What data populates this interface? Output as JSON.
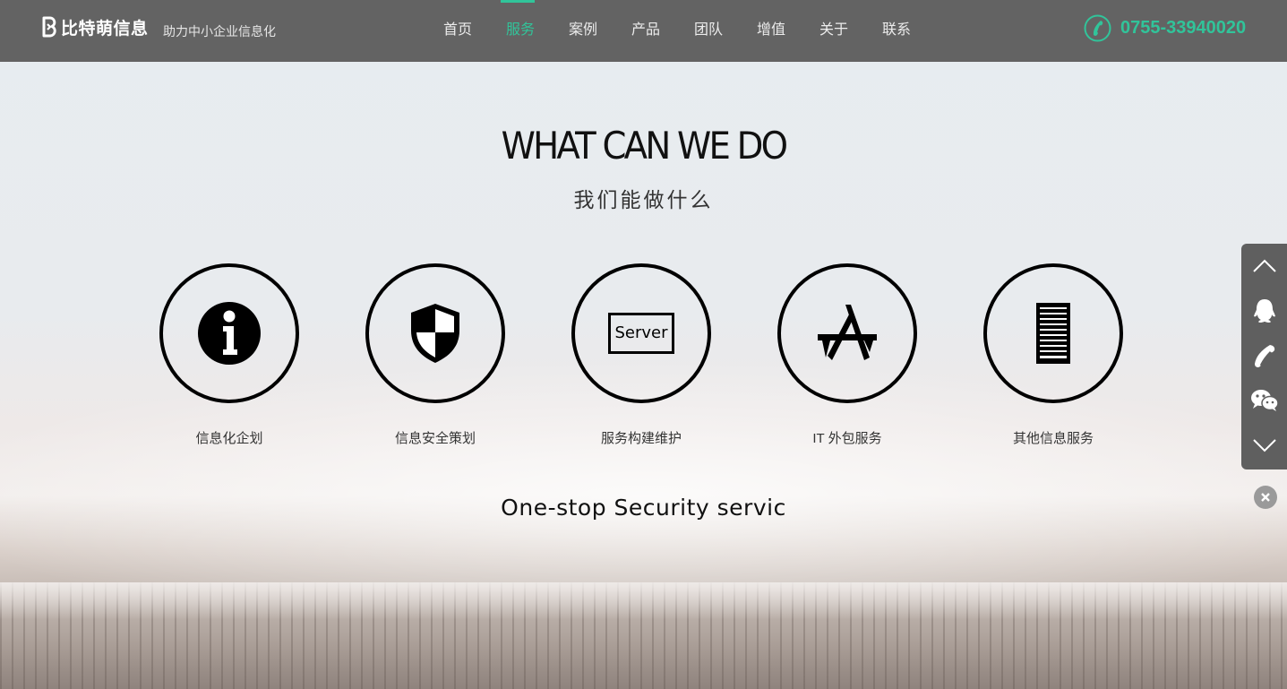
{
  "header": {
    "brand": "比特萌信息",
    "slogan": "助力中小企业信息化",
    "nav": [
      {
        "label": "首页",
        "active": false
      },
      {
        "label": "服务",
        "active": true
      },
      {
        "label": "案例",
        "active": false
      },
      {
        "label": "产品",
        "active": false
      },
      {
        "label": "团队",
        "active": false
      },
      {
        "label": "增值",
        "active": false
      },
      {
        "label": "关于",
        "active": false
      },
      {
        "label": "联系",
        "active": false
      }
    ],
    "phone": "0755-33940020"
  },
  "section": {
    "title": "WHAT CAN WE DO",
    "subtitle": "我们能做什么",
    "tagline": "One-stop Security servic"
  },
  "services": [
    {
      "label": "信息化企划",
      "icon": "info-icon"
    },
    {
      "label": "信息安全策划",
      "icon": "shield-icon"
    },
    {
      "label": "服务构建维护",
      "icon": "server-icon",
      "icon_text": "Server"
    },
    {
      "label": "IT 外包服务",
      "icon": "app-store-icon"
    },
    {
      "label": "其他信息服务",
      "icon": "server-rack-icon"
    }
  ],
  "toolbar": {
    "items": [
      "arrow-up-icon",
      "qq-icon",
      "phone-icon",
      "wechat-icon",
      "arrow-down-icon"
    ],
    "close": "close-icon"
  },
  "colors": {
    "header_bg": "#636363",
    "accent": "#31c49a",
    "toolbar_bg": "#5f5f5f"
  }
}
